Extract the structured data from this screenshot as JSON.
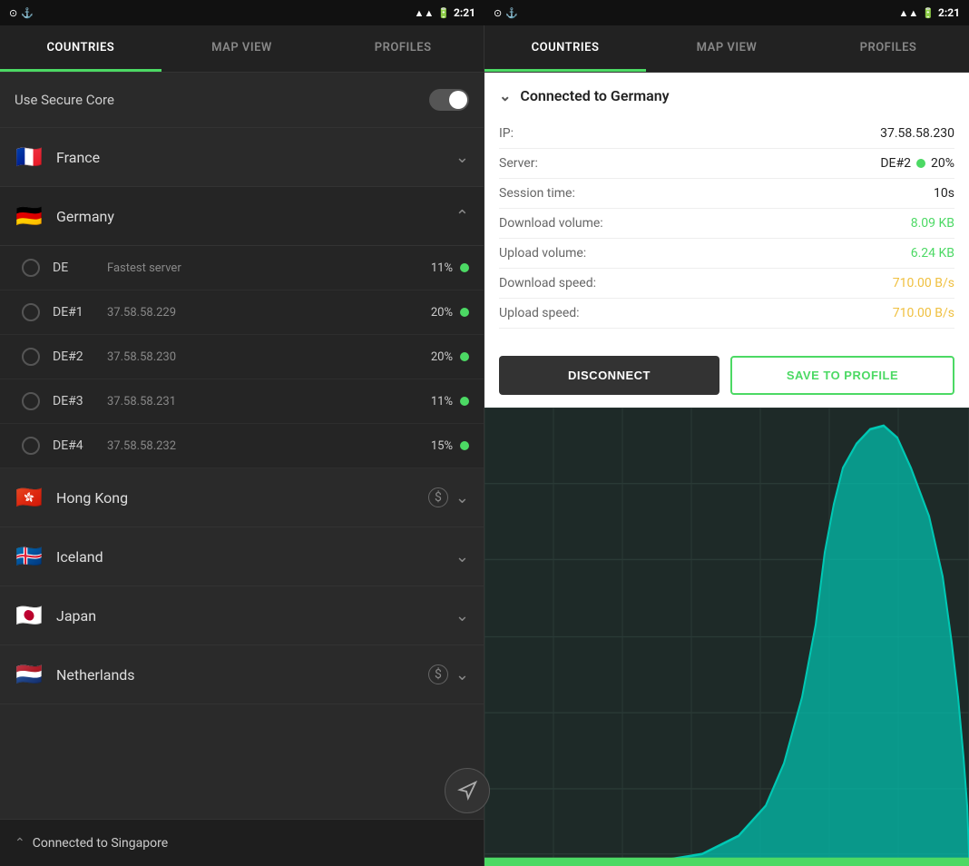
{
  "statusBar": {
    "leftIcon": "⊙",
    "rightIcon": "⊙",
    "time": "2:21",
    "batteryIcon": "🔋",
    "wifiIcon": "📶"
  },
  "leftPanel": {
    "tabs": [
      {
        "label": "COUNTRIES",
        "active": true
      },
      {
        "label": "MAP VIEW",
        "active": false
      },
      {
        "label": "PROFILES",
        "active": false
      }
    ],
    "secureCore": {
      "label": "Use Secure Core"
    },
    "countries": [
      {
        "flag": "🇫🇷",
        "name": "France",
        "expanded": false,
        "paidIcon": false
      },
      {
        "flag": "🇩🇪",
        "name": "Germany",
        "expanded": true,
        "paidIcon": false
      },
      {
        "flag": "🇭🇰",
        "name": "Hong Kong",
        "expanded": false,
        "paidIcon": true
      },
      {
        "flag": "🇮🇸",
        "name": "Iceland",
        "expanded": false,
        "paidIcon": false
      },
      {
        "flag": "🇯🇵",
        "name": "Japan",
        "expanded": false,
        "paidIcon": false
      },
      {
        "flag": "🇳🇱",
        "name": "Netherlands",
        "expanded": false,
        "paidIcon": true
      }
    ],
    "servers": [
      {
        "name": "DE",
        "ip": "Fastest server",
        "load": "11%"
      },
      {
        "name": "DE#1",
        "ip": "37.58.58.229",
        "load": "20%"
      },
      {
        "name": "DE#2",
        "ip": "37.58.58.230",
        "load": "20%"
      },
      {
        "name": "DE#3",
        "ip": "37.58.58.231",
        "load": "11%"
      },
      {
        "name": "DE#4",
        "ip": "37.58.58.232",
        "load": "15%"
      }
    ],
    "bottomBar": {
      "label": "Connected to Singapore"
    }
  },
  "rightPanel": {
    "tabs": [
      {
        "label": "COUNTRIES",
        "active": true
      },
      {
        "label": "MAP VIEW",
        "active": false
      },
      {
        "label": "PROFILES",
        "active": false
      }
    ],
    "connected": {
      "header": "Connected to Germany",
      "ip": {
        "label": "IP:",
        "value": "37.58.58.230"
      },
      "server": {
        "label": "Server:",
        "serverName": "DE#2",
        "load": "20%"
      },
      "sessionTime": {
        "label": "Session time:",
        "value": "10s"
      },
      "downloadVolume": {
        "label": "Download volume:",
        "value": "8.09 KB"
      },
      "uploadVolume": {
        "label": "Upload volume:",
        "value": "6.24 KB"
      },
      "downloadSpeed": {
        "label": "Download speed:",
        "value": "710.00 B/s"
      },
      "uploadSpeed": {
        "label": "Upload speed:",
        "value": "710.00 B/s"
      },
      "disconnectLabel": "DISCONNECT",
      "saveLabel": "SAVE TO PROFILE"
    }
  }
}
